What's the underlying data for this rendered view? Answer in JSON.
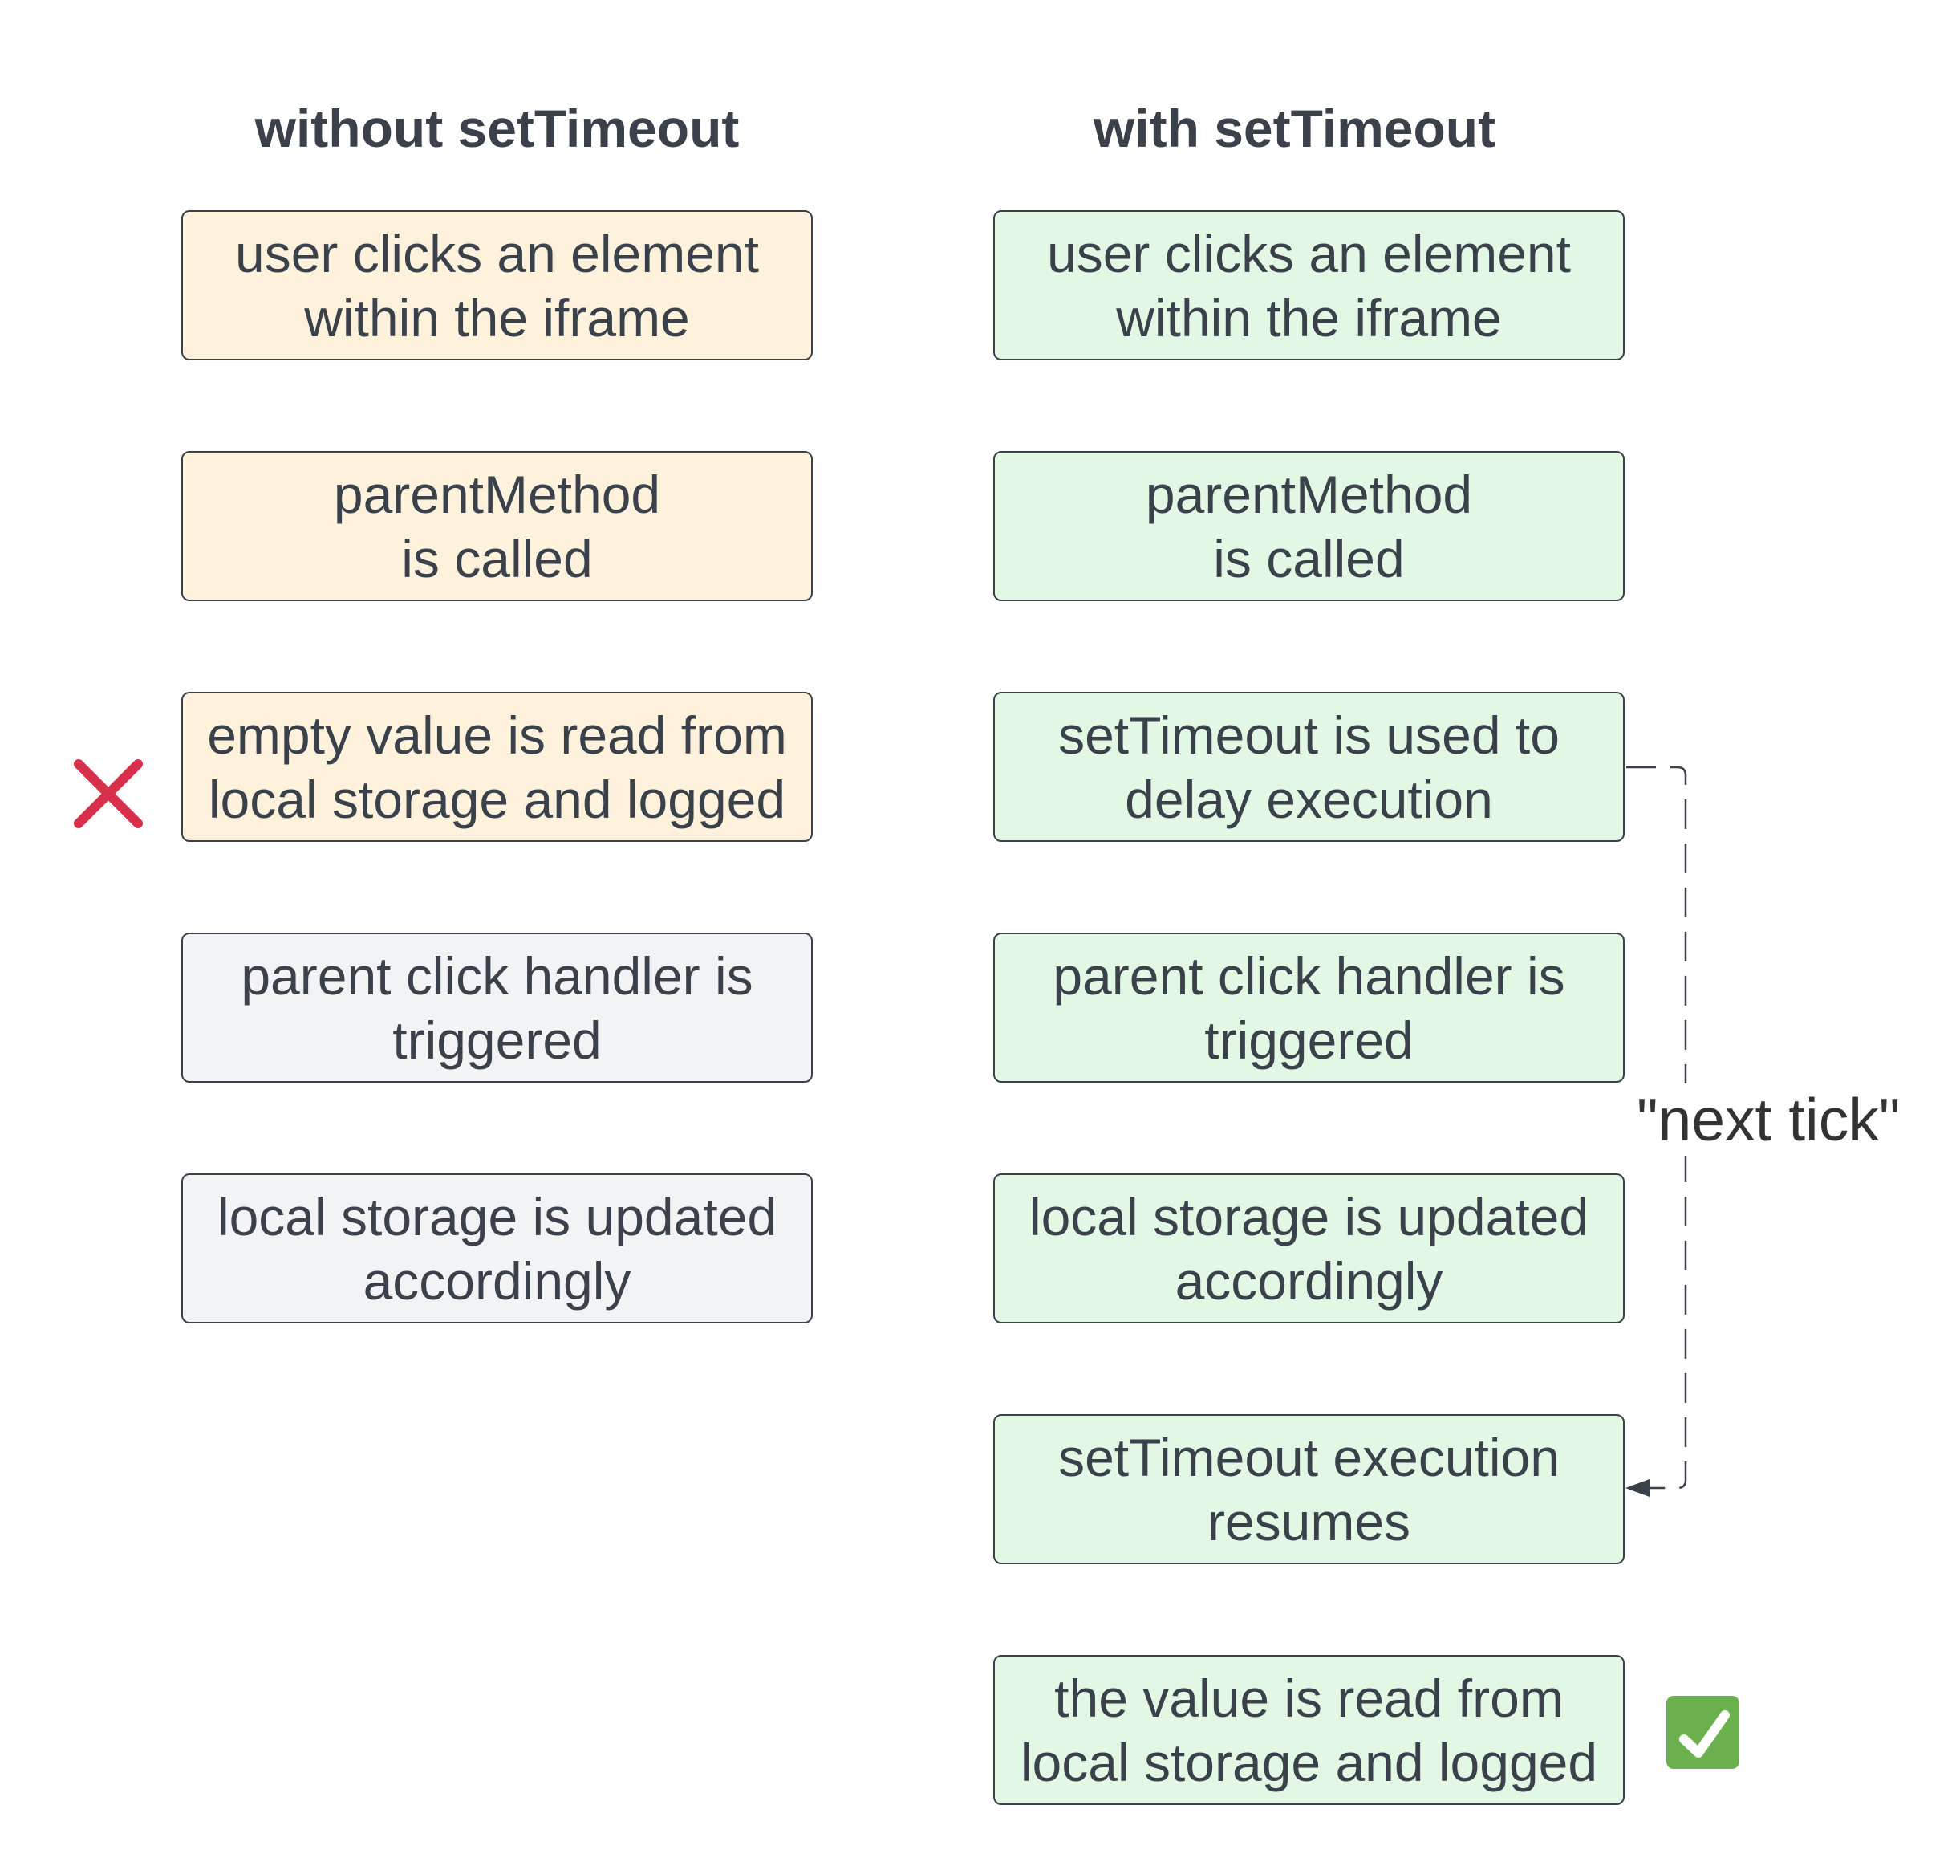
{
  "columns": {
    "left": {
      "title": "without setTimeout",
      "steps": [
        {
          "text": "user clicks an element\nwithin the iframe",
          "style": "yellow"
        },
        {
          "text": "parentMethod\nis called",
          "style": "yellow"
        },
        {
          "text": "empty value is read from\nlocal storage and logged",
          "style": "yellow"
        },
        {
          "text": "parent click handler is\ntriggered",
          "style": "grey"
        },
        {
          "text": "local storage is updated\naccordingly",
          "style": "grey"
        }
      ],
      "marker": {
        "icon": "cross-icon",
        "step_index": 2,
        "color": "#d8304a"
      }
    },
    "right": {
      "title": "with setTimeout",
      "steps": [
        {
          "text": "user clicks an element\nwithin the iframe",
          "style": "green"
        },
        {
          "text": "parentMethod\nis called",
          "style": "green"
        },
        {
          "text": "setTimeout is used to\ndelay execution",
          "style": "green"
        },
        {
          "text": "parent click handler is\ntriggered",
          "style": "green"
        },
        {
          "text": "local storage is updated\naccordingly",
          "style": "green"
        },
        {
          "text": "setTimeout execution\nresumes",
          "style": "green"
        },
        {
          "text": "the value is read from\nlocal storage and logged",
          "style": "green"
        }
      ],
      "marker": {
        "icon": "check-icon",
        "step_index": 6,
        "color": "#6ab04c"
      }
    }
  },
  "connector": {
    "label": "\"next tick\"",
    "from_step": 2,
    "to_step": 5,
    "style": "dashed"
  },
  "colors": {
    "text": "#3a414a",
    "border": "#3a414a",
    "yellow_fill": "#fef2dc",
    "grey_fill": "#f2f3f5",
    "green_fill": "#e2f8e4",
    "label_text": "#333333"
  }
}
